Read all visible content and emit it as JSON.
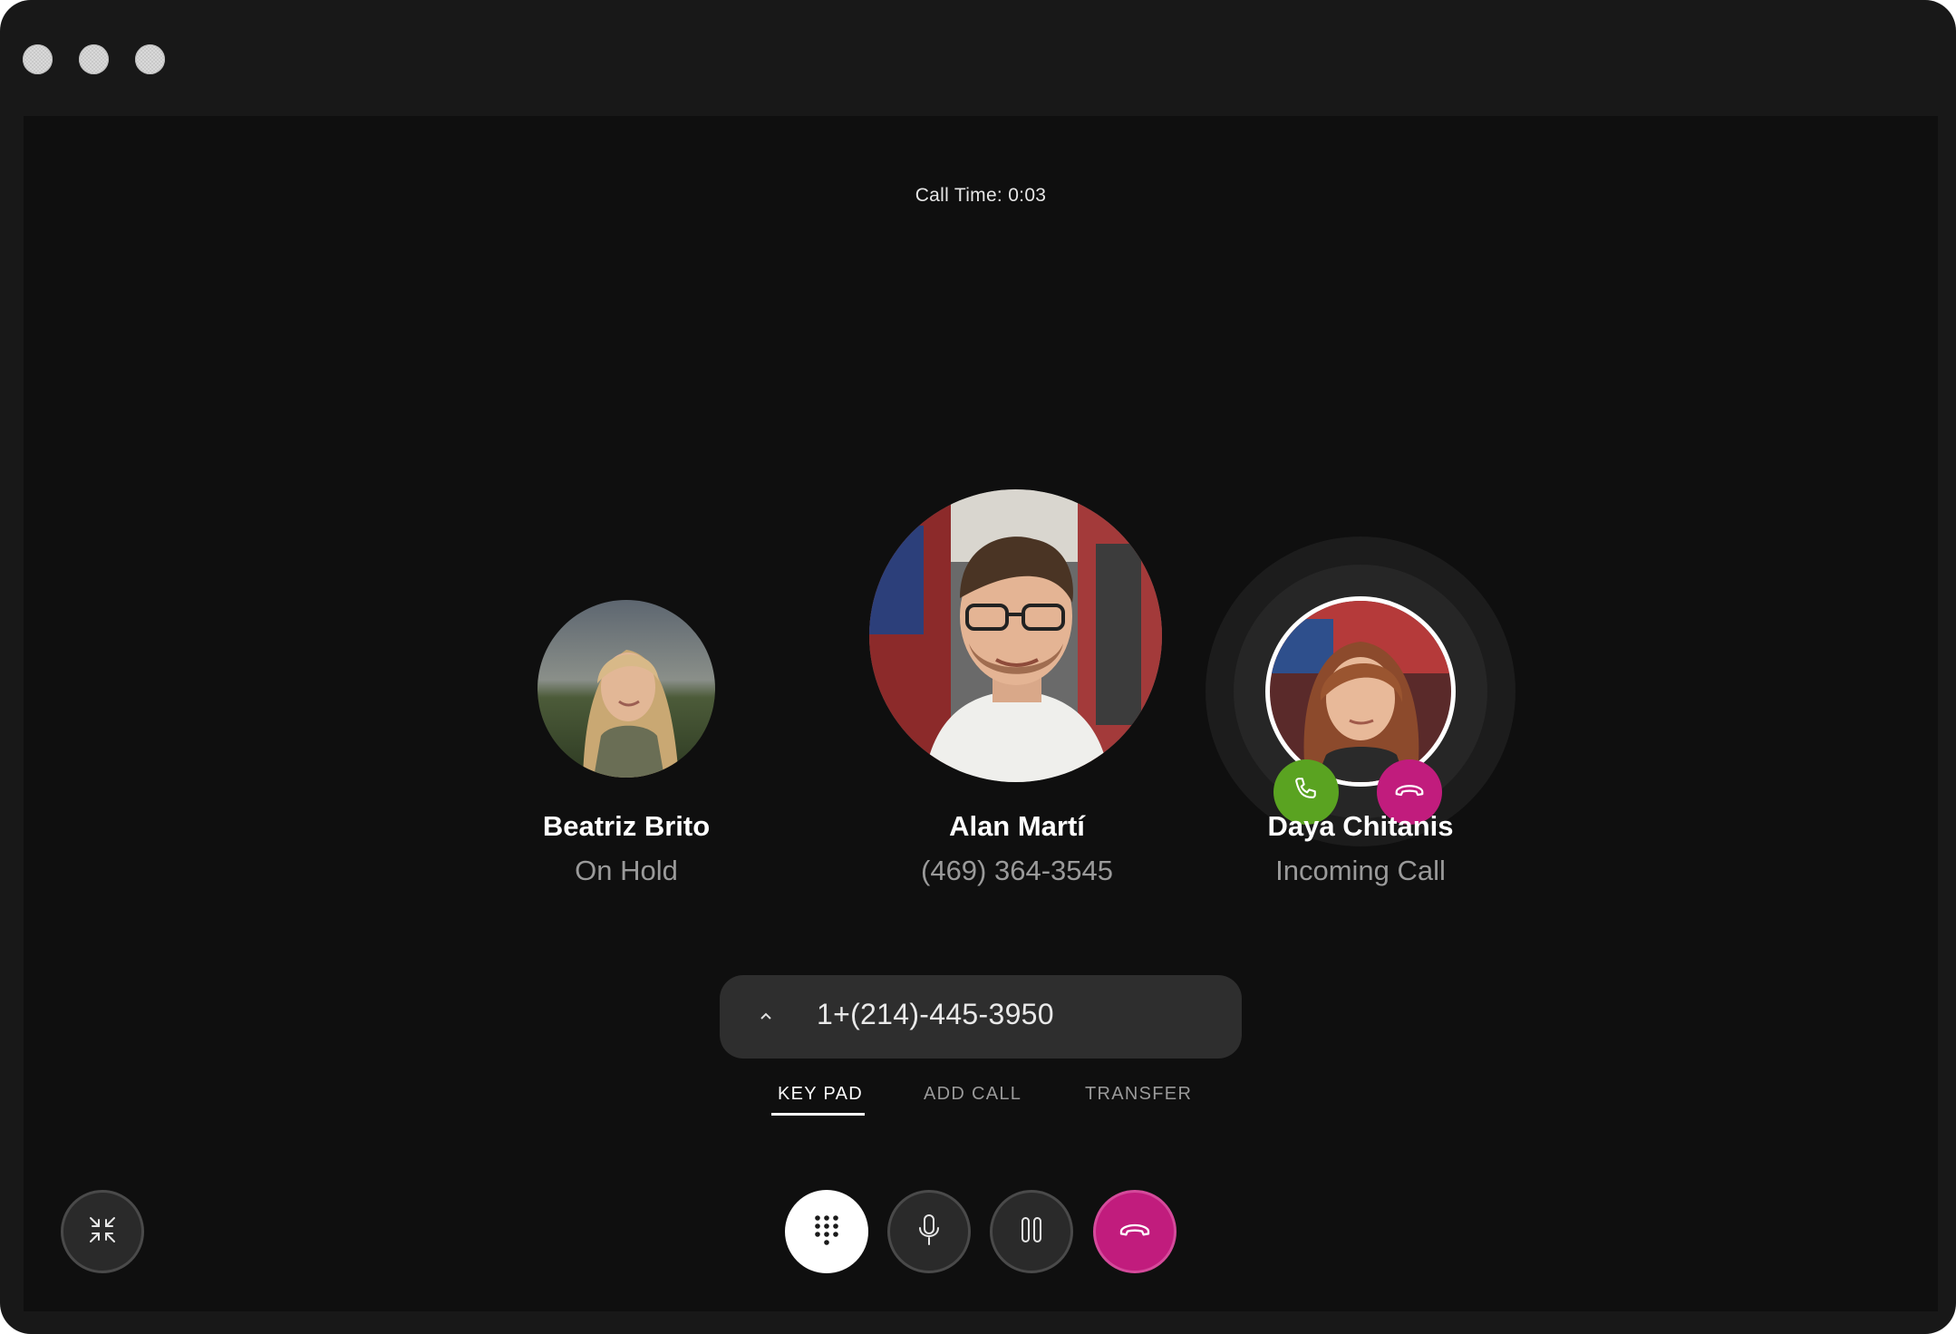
{
  "window": {
    "controls": [
      "close",
      "minimize",
      "maximize"
    ]
  },
  "call": {
    "time_label": "Call Time: 0:03"
  },
  "participants": [
    {
      "name": "Beatriz Brito",
      "status": "On Hold"
    },
    {
      "name": "Alan Martí",
      "status": "(469) 364-3545"
    },
    {
      "name": "Daya Chitanis",
      "status": "Incoming Call"
    }
  ],
  "incoming": {
    "accept_icon": "phone-icon",
    "decline_icon": "hang-up-icon",
    "accept_color": "#5aa321",
    "decline_color": "#c11c7d"
  },
  "dialer": {
    "number": "1+(214)-445-3950",
    "expand_icon": "chevron-up-icon"
  },
  "tabs": [
    {
      "label": "KEY PAD",
      "active": true
    },
    {
      "label": "ADD CALL",
      "active": false
    },
    {
      "label": "TRANSFER",
      "active": false
    }
  ],
  "controls": {
    "collapse_icon": "collapse-arrows-icon",
    "keypad_icon": "keypad-icon",
    "mute_icon": "microphone-icon",
    "hold_icon": "pause-icon",
    "end_icon": "hang-up-icon"
  },
  "colors": {
    "accent_pink": "#c11c7d",
    "accent_green": "#5aa321",
    "background": "#0f0f0f"
  }
}
